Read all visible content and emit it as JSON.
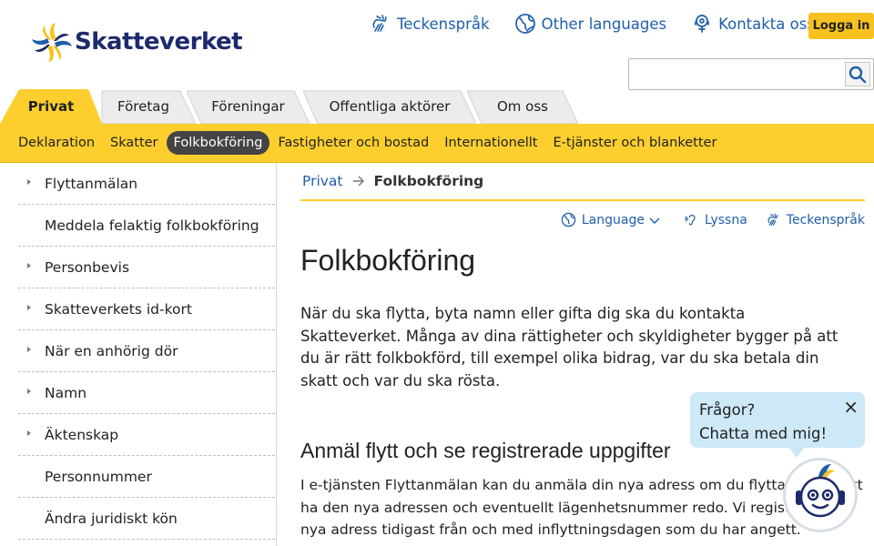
{
  "header": {
    "logo_text": "Skatteverket",
    "links": [
      {
        "label": "Teckenspråk",
        "icon": "sign-language-icon"
      },
      {
        "label": "Other languages",
        "icon": "globe-icon"
      },
      {
        "label": "Kontakta oss",
        "icon": "contact-headset-icon"
      }
    ],
    "login_label": "Logga in",
    "search": {
      "value": "",
      "placeholder": ""
    }
  },
  "tabs": [
    {
      "label": "Privat",
      "active": true
    },
    {
      "label": "Företag",
      "active": false
    },
    {
      "label": "Föreningar",
      "active": false
    },
    {
      "label": "Offentliga aktörer",
      "active": false
    },
    {
      "label": "Om oss",
      "active": false
    }
  ],
  "subnav": [
    {
      "label": "Deklaration",
      "active": false
    },
    {
      "label": "Skatter",
      "active": false
    },
    {
      "label": "Folkbokföring",
      "active": true
    },
    {
      "label": "Fastigheter och bostad",
      "active": false
    },
    {
      "label": "Internationellt",
      "active": false
    },
    {
      "label": "E-tjänster och blanketter",
      "active": false
    }
  ],
  "sidebar": {
    "items": [
      {
        "label": "Flyttanmälan",
        "has_children": true
      },
      {
        "label": "Meddela felaktig folkbokföring",
        "has_children": false
      },
      {
        "label": "Personbevis",
        "has_children": true
      },
      {
        "label": "Skatteverkets id-kort",
        "has_children": true
      },
      {
        "label": "När en anhörig dör",
        "has_children": true
      },
      {
        "label": "Namn",
        "has_children": true
      },
      {
        "label": "Äktenskap",
        "has_children": true
      },
      {
        "label": "Personnummer",
        "has_children": false
      },
      {
        "label": "Ändra juridiskt kön",
        "has_children": false
      }
    ]
  },
  "breadcrumb": {
    "home": "Privat",
    "current": "Folkbokföring"
  },
  "tools": {
    "language": "Language",
    "listen": "Lyssna",
    "sign": "Teckenspråk"
  },
  "main": {
    "title": "Folkbokföring",
    "intro": "När du ska flytta, byta namn eller gifta dig ska du kontakta Skatteverket. Många av dina rättigheter och skyldigheter bygger på att du är rätt folkbokförd, till exempel olika bidrag, var du ska betala din skatt och var du ska rösta.",
    "section_title": "Anmäl flytt och se registrerade uppgifter",
    "section_text": "I e-tjänsten Flyttanmälan kan du anmäla din nya adress om du flyttar. Se till att ha den nya adressen och eventuellt lägenhetsnummer redo. Vi registrerar din nya adress tidigast från och med inflyttningsdagen som du har angett."
  },
  "chat": {
    "line1": "Frågor?",
    "line2": "Chatta med mig!",
    "close": "×"
  },
  "colors": {
    "brand_yellow": "#fccf2e",
    "link_blue": "#1f5fa8",
    "navy": "#1d2a6b",
    "active_pill": "#444444"
  }
}
